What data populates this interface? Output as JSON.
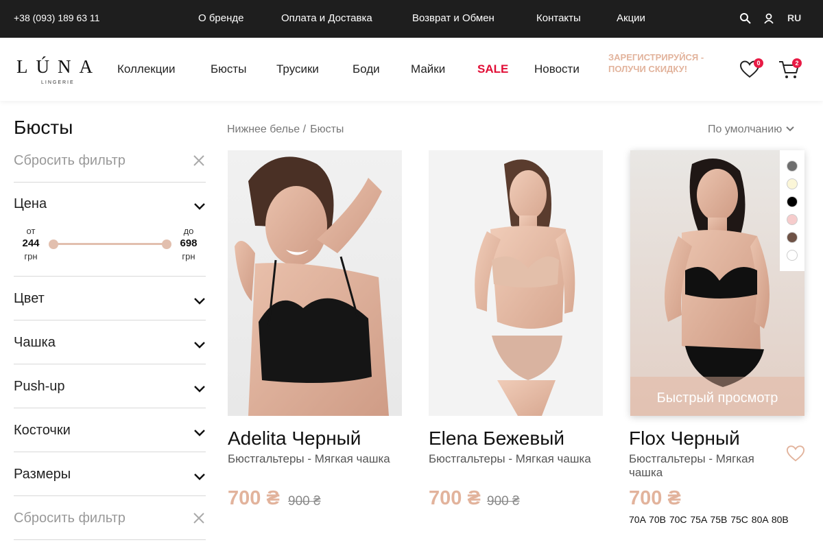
{
  "topbar": {
    "phone": "+38 (093) 189 63 11",
    "links": [
      "О бренде",
      "Оплата и Доставка",
      "Возврат и Обмен",
      "Контакты",
      "Акции"
    ],
    "lang": "RU",
    "search_icon": "search-icon",
    "user_icon": "user-icon"
  },
  "header": {
    "logo_word": "LÚNA",
    "logo_sub": "LINGERIE",
    "nav": [
      "Коллекции",
      "Бюсты",
      "Трусики",
      "Боди",
      "Майки",
      "SALE",
      "Новости"
    ],
    "promo": "ЗАРЕГИСТРИРУЙСЯ - ПОЛУЧИ СКИДКУ!",
    "wishlist_count": "0",
    "cart_count": "2"
  },
  "sidebar": {
    "title": "Бюсты",
    "reset_label": "Сбросить фильтр",
    "price": {
      "label": "Цена",
      "from_label": "от",
      "from_value": "244",
      "to_label": "до",
      "to_value": "698",
      "currency": "грн"
    },
    "filters": [
      "Цвет",
      "Чашка",
      "Push-up",
      "Косточки",
      "Размеры"
    ]
  },
  "content": {
    "breadcrumb": [
      "Нижнее белье /",
      "Бюсты"
    ],
    "sort_label": "По умолчанию",
    "products": [
      {
        "title": "Adelita Черный",
        "category": "Бюстгальтеры - Мягкая чашка",
        "price": "700 ₴",
        "old_price": "900 ₴"
      },
      {
        "title": "Elena Бежевый",
        "category": "Бюстгальтеры - Мягкая чашка",
        "price": "700 ₴",
        "old_price": "900 ₴"
      },
      {
        "title": "Flox Черный",
        "category": "Бюстгальтеры - Мягкая чашка",
        "price": "700 ₴",
        "quick_view": "Быстрый просмотр",
        "sizes": "70A 70B 70C 75A 75B 75C 80A 80B",
        "swatches": [
          "#6e6e6e",
          "#fbf6d8",
          "#000000",
          "#f6cccc",
          "#6e5246",
          "#ffffff"
        ]
      }
    ]
  },
  "colors": {
    "accent": "#e2b39c",
    "sale": "#e10d35",
    "topbar_bg": "#1e1e1e",
    "badge": "#e81b45"
  }
}
